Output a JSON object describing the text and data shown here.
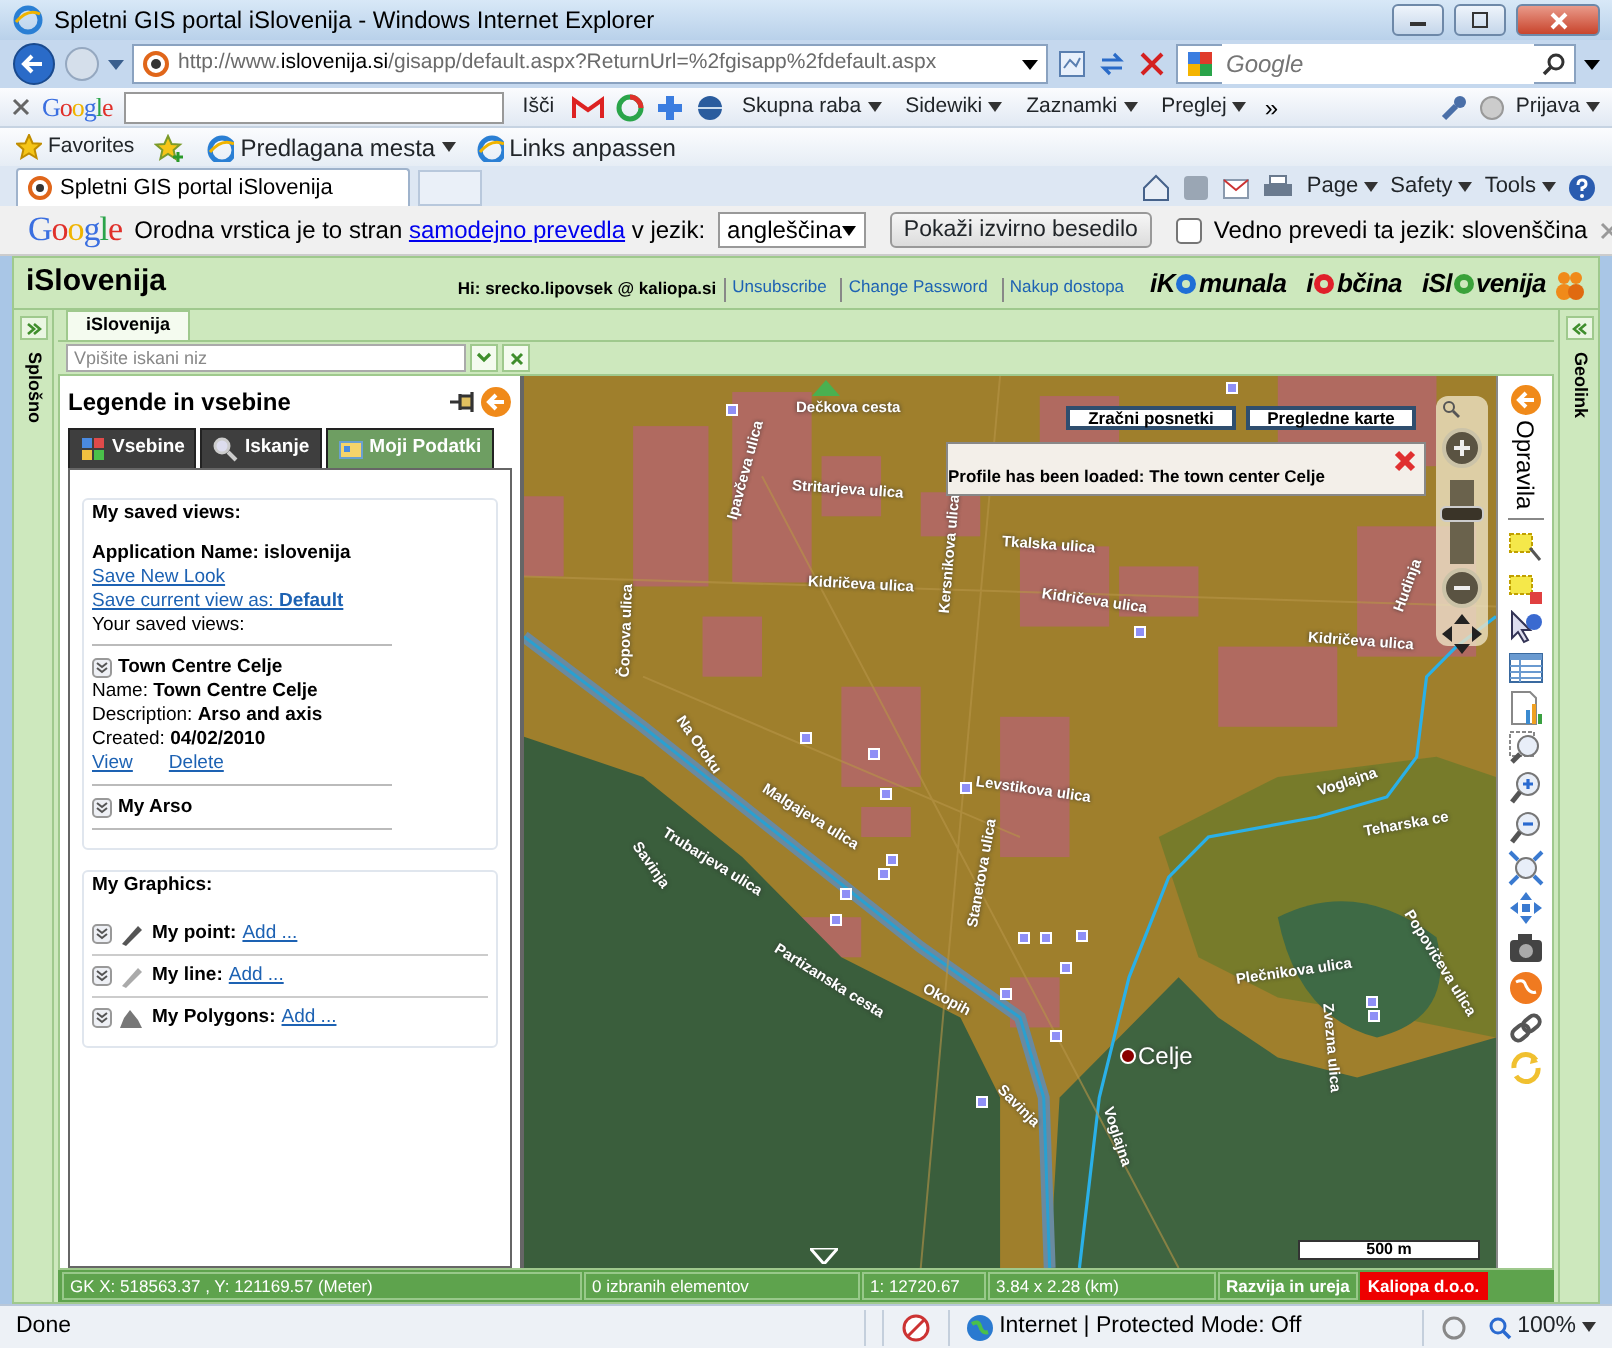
{
  "window": {
    "title": "Spletni GIS portal iSlovenija - Windows Internet Explorer"
  },
  "address_bar": {
    "url_prefix": "http://www.",
    "url_domain": "islovenija.si",
    "url_rest": "/gisapp/default.aspx?ReturnUrl=%2fgisapp%2fdefault.aspx",
    "search_placeholder": "Google"
  },
  "google_toolbar": {
    "logo": "Google",
    "search_button": "Išči",
    "items": [
      "Skupna raba",
      "Sidewiki",
      "Zaznamki",
      "Preglej"
    ],
    "more": "»",
    "sign_in": "Prijava"
  },
  "favorites_bar": {
    "label": "Favorites",
    "items": [
      "Predlagana mesta",
      "Links anpassen"
    ]
  },
  "tabs": [
    {
      "label": "Spletni GIS portal iSlovenija",
      "selected": true
    }
  ],
  "command_bar": [
    "Page",
    "Safety",
    "Tools"
  ],
  "translate_bar": {
    "logo": "Google",
    "text_before": "Orodna vrstica je to stran ",
    "link": "samodejno prevedla",
    "text_after": " v jezik:",
    "language": "angleščina",
    "button": "Pokaži izvirno besedilo",
    "always_label": "Vedno prevedi ta jezik: slovenščina",
    "always_checked": false
  },
  "app_header": {
    "title": "iSlovenija",
    "greeting": "Hi:",
    "user": "srecko.lipovsek @ kaliopa.si",
    "links": [
      "Unsubscribe",
      "Change Password",
      "Nakup dostopa"
    ],
    "brands": [
      {
        "before": "iK",
        "after": "munala",
        "color": "#1f6fd6"
      },
      {
        "before": "i",
        "after": "bčina",
        "color": "#e0202a"
      },
      {
        "before": "iSl",
        "after": "venija",
        "color": "#3aa23a"
      }
    ]
  },
  "side_strips": {
    "left": "Splošno",
    "right": "Geolink"
  },
  "app_tabs": [
    {
      "label": "iSlovenija",
      "selected": true
    }
  ],
  "search": {
    "placeholder": "Vpišite iskani niz"
  },
  "panel": {
    "title": "Legende in vsebine",
    "tabs": [
      {
        "label": "Vsebine",
        "selected": false
      },
      {
        "label": "Iskanje",
        "selected": false
      },
      {
        "label": "Moji Podatki",
        "selected": true
      }
    ],
    "saved_views": {
      "heading": "My saved views:",
      "app_name": "Application Name: islovenija",
      "save_new": "Save New Look",
      "save_current": "Save current view as: **Default**",
      "your_views": "Your saved views:",
      "views": [
        {
          "title": "Town Centre Celje",
          "fields": [
            {
              "label": "Name:",
              "value": "Town Centre Celje"
            },
            {
              "label": "Description:",
              "value": "Arso and axis"
            },
            {
              "label": "Created:",
              "value": "04/02/2010"
            }
          ],
          "actions": [
            "View",
            "Delete"
          ]
        },
        {
          "title": "My Arso"
        }
      ]
    },
    "graphics": {
      "heading": "My Graphics:",
      "items": [
        {
          "label": "My point:",
          "action": "Add ..."
        },
        {
          "label": "My line:",
          "action": "Add ..."
        },
        {
          "label": "My Polygons:",
          "action": "Add ..."
        }
      ]
    }
  },
  "map": {
    "buttons": [
      "Zračni posnetki",
      "Pregledne karte"
    ],
    "notice": "Profile has been loaded: The town center Celje",
    "zoom": {
      "level": 0.62
    },
    "scale": "500 m",
    "labels": [
      "Dečkova cesta",
      "Stritarjeva ulica",
      "Ipavčeva ulica",
      "Kidričeva ulica",
      "Kersnikova ulica",
      "Tkalska ulica",
      "Kidričeva ulica",
      "Kidričeva ulica",
      "Čopova ulica",
      "Na Otoku",
      "Malgajeva ulica",
      "Trubarjeva ulica",
      "Savinja",
      "Partizanska cesta",
      "Levstikova ulica",
      "Stanetova ulica",
      "Okopih",
      "Savinja",
      "Celje",
      "Voglajna",
      "Voglajna",
      "Plečnikova ulica",
      "Zvezna ulica",
      "Hudinja",
      "Teharska ce",
      "Popovičeva ulica"
    ]
  },
  "tools_panel": {
    "title": "Opravila"
  },
  "status": {
    "coords": "GK X: 518563.37 , Y: 121169.57 (Meter)",
    "selected": "0 izbranih elementov",
    "scale": "1: 12720.67",
    "extent": "3.84 x 2.28 (km)",
    "credit_label": "Razvija in ureja",
    "credit": "Kaliopa d.o.o."
  },
  "ie_status": {
    "state": "Done",
    "zone": "Internet | Protected Mode: Off",
    "zoom": "100%"
  }
}
